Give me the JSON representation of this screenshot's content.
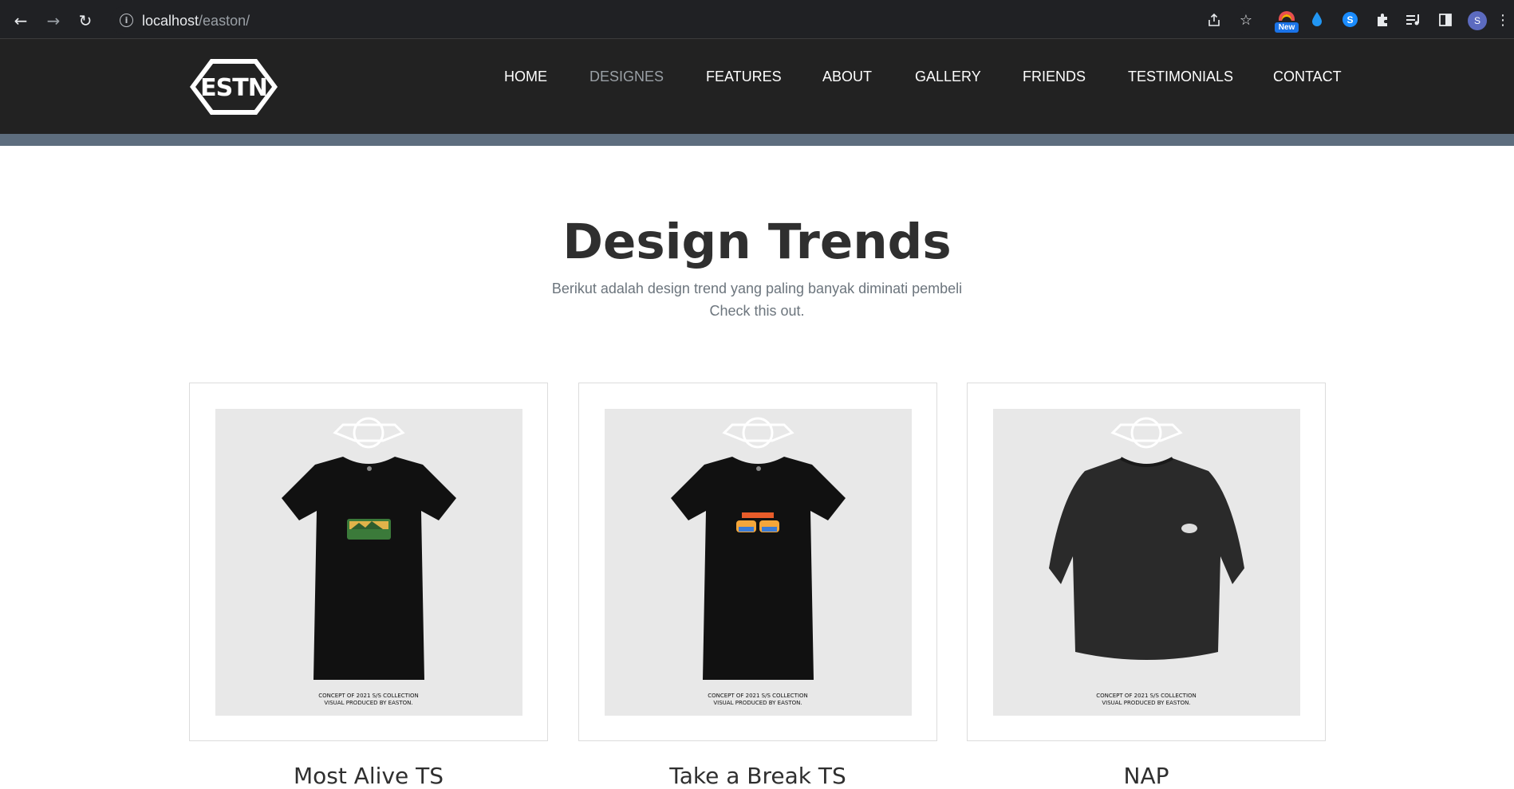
{
  "browser": {
    "url_host": "localhost",
    "url_path": "/easton/",
    "ext_badge": "New",
    "profile_initial": "S"
  },
  "site": {
    "logo_text": "ESTN",
    "nav": [
      "HOME",
      "DESIGNES",
      "FEATURES",
      "ABOUT",
      "GALLERY",
      "FRIENDS",
      "TESTIMONIALS",
      "CONTACT"
    ],
    "active_nav": "DESIGNES"
  },
  "section": {
    "title": "Design Trends",
    "subtitle_line1": "Berikut adalah design trend yang paling banyak diminati pembeli",
    "subtitle_line2": "Check this out."
  },
  "products": [
    {
      "name": "Most Alive TS",
      "garment": "t-shirt",
      "caption_line1": "CONCEPT OF 2021 S/S COLLECTION",
      "caption_line2": "VISUAL PRODUCED BY EASTON."
    },
    {
      "name": "Take a Break TS",
      "garment": "t-shirt",
      "caption_line1": "CONCEPT OF 2021 S/S COLLECTION",
      "caption_line2": "VISUAL PRODUCED BY EASTON."
    },
    {
      "name": "NAP",
      "garment": "sweatshirt",
      "caption_line1": "CONCEPT OF 2021 S/S COLLECTION",
      "caption_line2": "VISUAL PRODUCED BY EASTON."
    }
  ],
  "colors": {
    "header_bg": "#222222",
    "strip": "#5d6d7e",
    "title": "#2f2f2f",
    "subtitle": "#6c757d"
  }
}
